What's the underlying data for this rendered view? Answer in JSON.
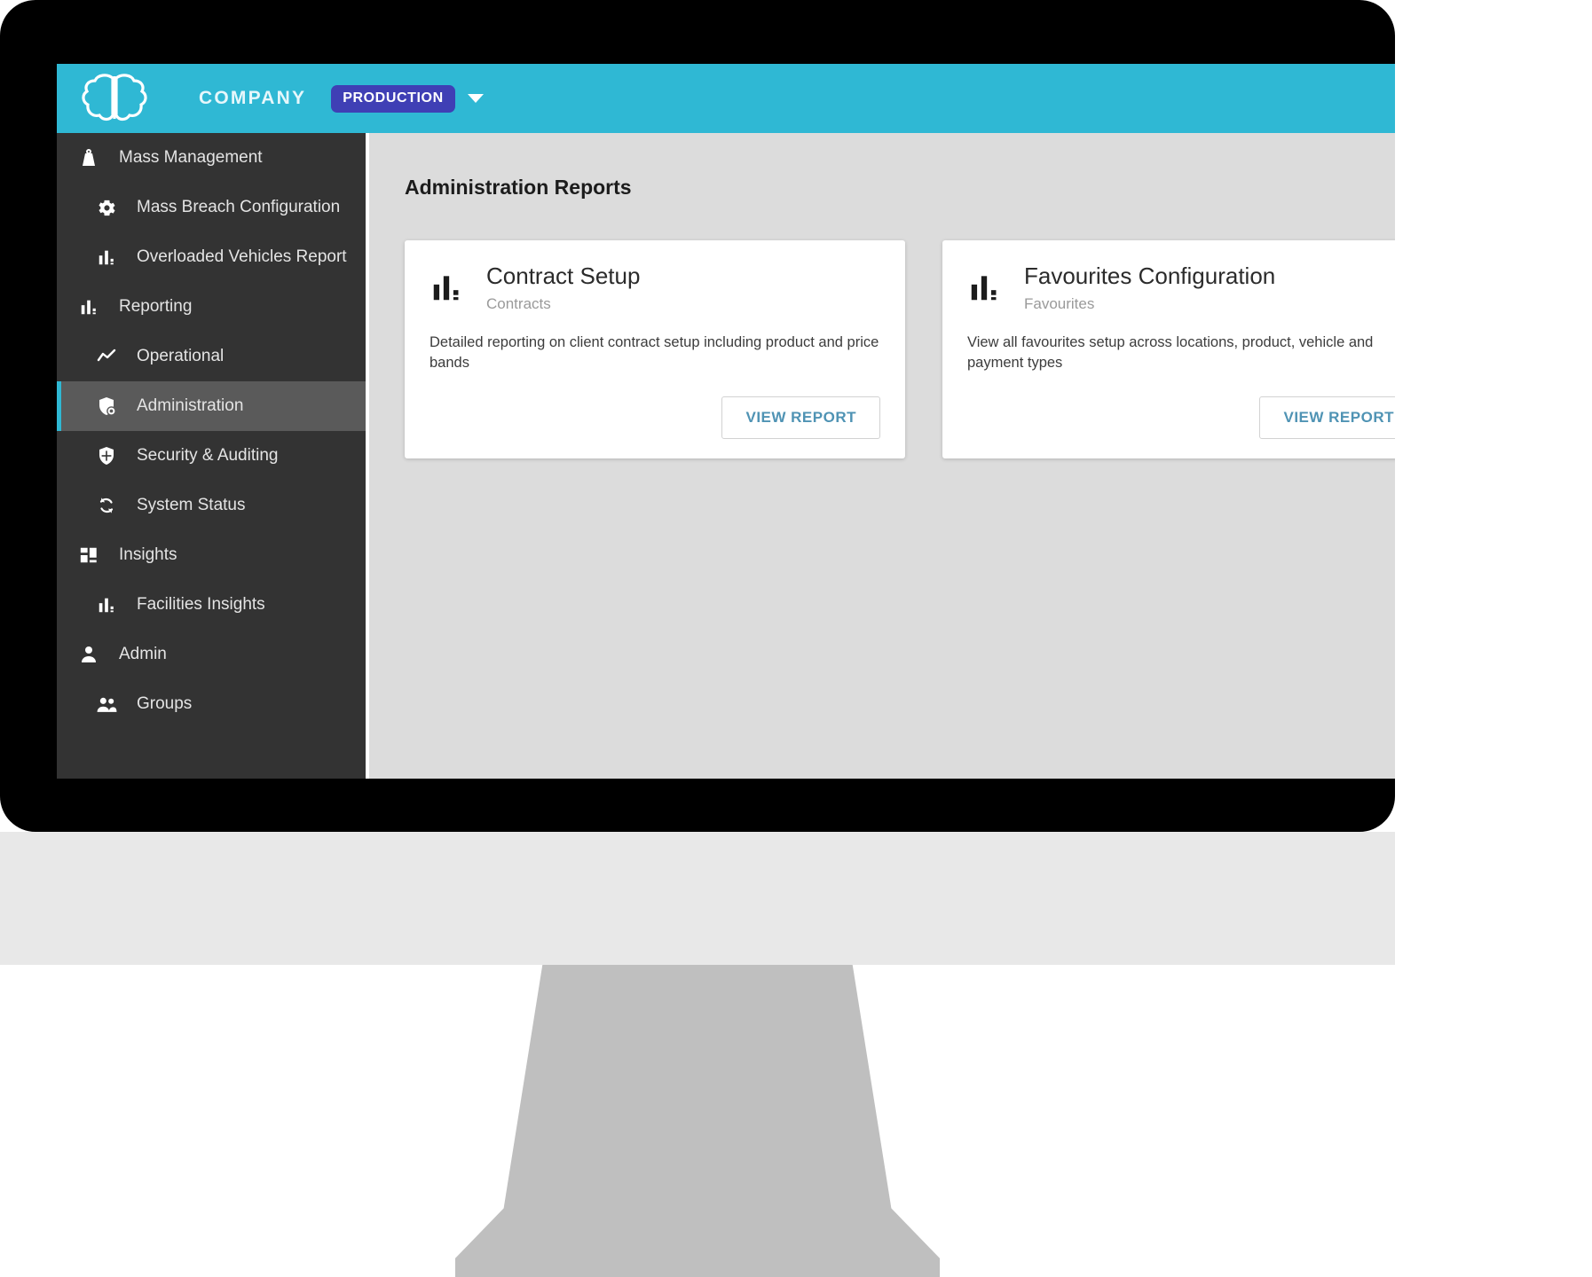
{
  "header": {
    "logo_icon": "brain-logo-icon",
    "company": "COMPANY",
    "environment_badge": "PRODUCTION",
    "caret_icon": "chevron-down-icon",
    "background_color": "#2fb8d4",
    "badge_color": "#3f3fb5"
  },
  "sidebar": {
    "background_color": "#333333",
    "active_color": "#5a5a5a",
    "active_accent": "#2fb8d4",
    "items": [
      {
        "label": "Mass Management",
        "icon": "weight-icon",
        "level": "top",
        "active": false
      },
      {
        "label": "Mass Breach Configuration",
        "icon": "gear-icon",
        "level": "sub",
        "active": false
      },
      {
        "label": "Overloaded Vehicles Report",
        "icon": "bar-chart-icon",
        "level": "sub",
        "active": false
      },
      {
        "label": "Reporting",
        "icon": "bar-chart-icon",
        "level": "top",
        "active": false
      },
      {
        "label": "Operational",
        "icon": "trend-line-icon",
        "level": "sub",
        "active": false
      },
      {
        "label": "Administration",
        "icon": "shield-admin-icon",
        "level": "sub",
        "active": true
      },
      {
        "label": "Security & Auditing",
        "icon": "shield-icon",
        "level": "sub",
        "active": false
      },
      {
        "label": "System Status",
        "icon": "refresh-icon",
        "level": "sub",
        "active": false
      },
      {
        "label": "Insights",
        "icon": "dashboard-grid-icon",
        "level": "top",
        "active": false
      },
      {
        "label": "Facilities Insights",
        "icon": "bar-chart-icon",
        "level": "sub",
        "active": false
      },
      {
        "label": "Admin",
        "icon": "person-icon",
        "level": "top",
        "active": false
      },
      {
        "label": "Groups",
        "icon": "people-icon",
        "level": "sub",
        "active": false
      }
    ]
  },
  "main": {
    "page_title": "Administration Reports",
    "cards": [
      {
        "icon": "bar-chart-icon",
        "title": "Contract Setup",
        "subtitle": "Contracts",
        "description": "Detailed reporting on client contract setup including product and price bands",
        "button_label": "VIEW REPORT"
      },
      {
        "icon": "bar-chart-icon",
        "title": "Favourites Configuration",
        "subtitle": "Favourites",
        "description": "View all favourites setup across locations, product, vehicle and payment types",
        "button_label": "VIEW REPORT"
      }
    ]
  }
}
